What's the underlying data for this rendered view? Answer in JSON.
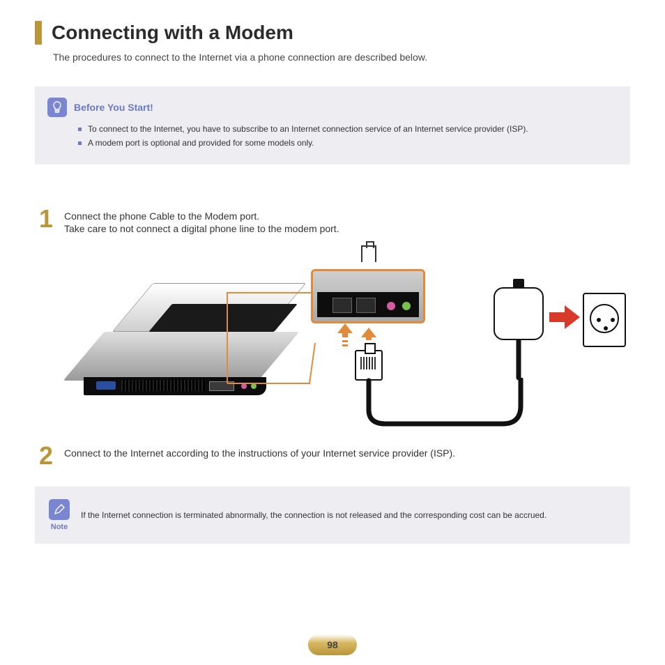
{
  "title": "Connecting with a Modem",
  "intro": "The procedures to connect to the Internet via a phone connection are described below.",
  "before": {
    "heading": "Before You Start!",
    "items": [
      "To connect to the Internet, you have to subscribe to an Internet connection service of an Internet service provider (ISP).",
      "A modem port is optional and provided for some models only."
    ]
  },
  "steps": [
    {
      "num": "1",
      "lines": [
        "Connect the phone Cable to the Modem port.",
        "Take care to not connect a digital phone line to the modem port."
      ]
    },
    {
      "num": "2",
      "lines": [
        "Connect to the Internet according to the instructions of your Internet service provider (ISP)."
      ]
    }
  ],
  "note": {
    "label": "Note",
    "text": "If the Internet connection is terminated abnormally, the connection is not released and the corresponding cost can be accrued."
  },
  "page_number": "98",
  "colors": {
    "accent_gold": "#b9963a",
    "accent_blue": "#6c79c8",
    "callout_orange": "#e08a3a",
    "arrow_red": "#d83a2a"
  }
}
